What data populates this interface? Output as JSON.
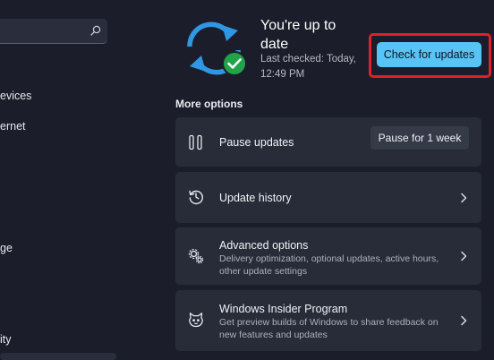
{
  "sidebar": {
    "search": {
      "value": "",
      "placeholder": ""
    },
    "items": [
      {
        "label": "evices"
      },
      {
        "label": "ernet"
      },
      {
        "label": "ge"
      },
      {
        "label": "ity"
      }
    ]
  },
  "status": {
    "title": "You're up to date",
    "last_checked": "Last checked: Today, 12:49 PM"
  },
  "actions": {
    "check_updates_label": "Check for updates"
  },
  "more_options": {
    "heading": "More options",
    "pause": {
      "title": "Pause updates",
      "button_label": "Pause for 1 week"
    },
    "history": {
      "title": "Update history"
    },
    "advanced": {
      "title": "Advanced options",
      "description": "Delivery optimization, optional updates, active hours, other update settings"
    },
    "insider": {
      "title": "Windows Insider Program",
      "description": "Get preview builds of Windows to share feedback on new features and updates"
    }
  },
  "colors": {
    "accent": "#58c3f5",
    "highlight": "#e0202a",
    "success": "#21a34a",
    "card": "#282c39",
    "background": "#1b1e2a"
  },
  "icons": {
    "search": "search-icon",
    "sync": "sync-icon",
    "check": "checkmark-icon",
    "pause": "pause-icon",
    "history": "history-icon",
    "advanced": "gears-icon",
    "insider": "insider-cat-icon",
    "chevron": "chevron-right-icon"
  }
}
